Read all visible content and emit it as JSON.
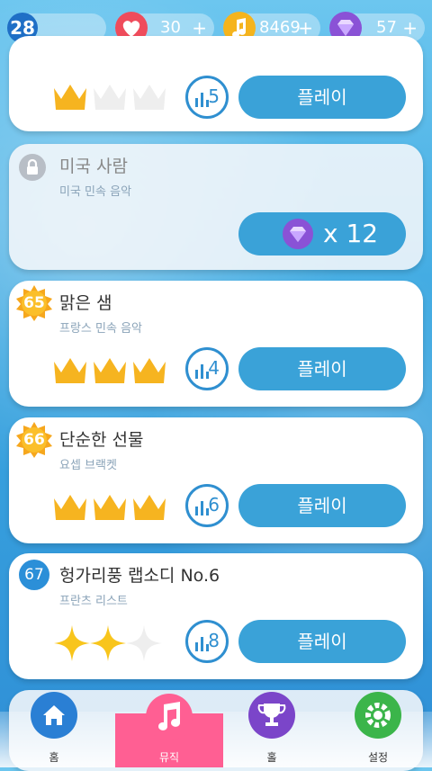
{
  "topbar": {
    "level": "28",
    "lives": "30",
    "notes": "8469",
    "gems": "57",
    "plus": "+"
  },
  "cards": [
    {
      "title": "",
      "subtitle": "",
      "stars": 1,
      "plays": "5",
      "button": "플레이"
    },
    {
      "title": "미국 사람",
      "subtitle": "미국 민속 음악",
      "gem_cost": "x 12"
    },
    {
      "badge": "65",
      "title": "맑은 샘",
      "subtitle": "프랑스 민속 음악",
      "stars": 3,
      "plays": "4",
      "button": "플레이"
    },
    {
      "badge": "66",
      "title": "단순한 선물",
      "subtitle": "요셉 브랙켓",
      "stars": 3,
      "plays": "6",
      "button": "플레이"
    },
    {
      "badge": "67",
      "title": "헝가리풍 랩소디 No.6",
      "subtitle": "프란츠 리스트",
      "stars": 2,
      "plays": "8",
      "button": "플레이"
    }
  ],
  "nav": {
    "home": "홈",
    "music": "뮤직",
    "hall": "홀",
    "settings": "설정"
  },
  "colors": {
    "accent": "#3aa2d8",
    "active_tab": "#ff5f93",
    "crown": "#f6b420"
  }
}
